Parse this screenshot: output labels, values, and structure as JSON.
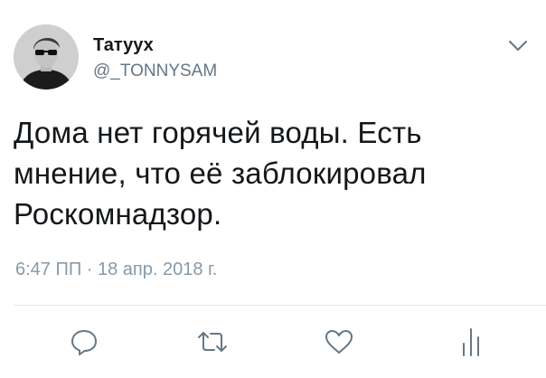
{
  "tweet": {
    "display_name": "Татуух",
    "handle": "@_TONNYSAM",
    "text_lines": [
      "Дома нет горячей воды. Есть",
      "мнение, что её заблокировал",
      "Роскомнадзор."
    ],
    "timestamp": "6:47 ПП · 18 апр. 2018 г."
  },
  "icons": {
    "menu": "chevron-down-icon",
    "reply": "reply-bubble-icon",
    "retweet": "retweet-icon",
    "like": "heart-icon",
    "analytics": "analytics-bars-icon"
  },
  "colors": {
    "text": "#14171a",
    "secondary": "#657786",
    "icon": "#657786",
    "divider": "#e1e8ed"
  }
}
